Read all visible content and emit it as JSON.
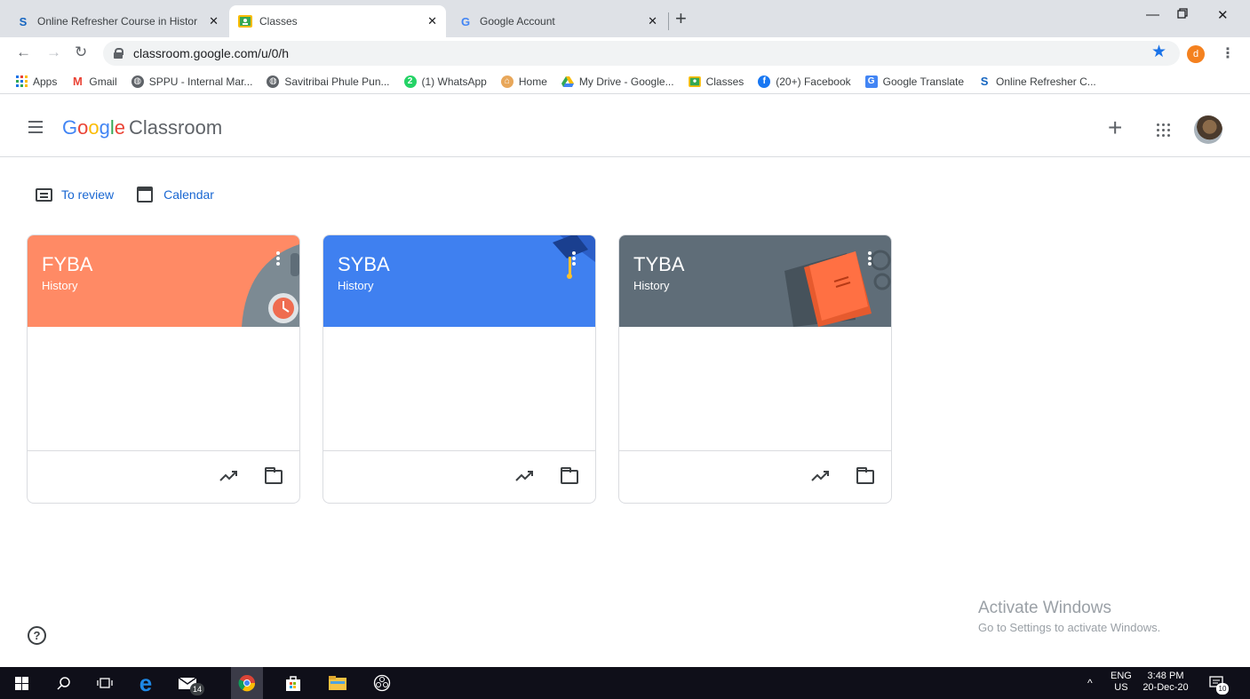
{
  "browser": {
    "tabs": [
      {
        "title": "Online Refresher Course in Histor",
        "favicon": "S",
        "favicon_color": "#1565c0",
        "active": false
      },
      {
        "title": "Classes",
        "favicon": "classroom-icon",
        "favicon_color": "#fbbc04",
        "active": true
      },
      {
        "title": "Google Account",
        "favicon": "G",
        "favicon_color": "#4285f4",
        "active": false
      }
    ],
    "url": "classroom.google.com/u/0/h",
    "profile_initial": "d",
    "bookmarks": [
      {
        "label": "Apps",
        "icon": "apps-grid-icon"
      },
      {
        "label": "Gmail",
        "icon": "gmail-icon"
      },
      {
        "label": "SPPU - Internal Mar...",
        "icon": "globe-icon"
      },
      {
        "label": "Savitribai Phule Pun...",
        "icon": "globe-icon"
      },
      {
        "label": "(1) WhatsApp",
        "icon": "whatsapp-icon"
      },
      {
        "label": "Home",
        "icon": "home-icon"
      },
      {
        "label": "My Drive - Google...",
        "icon": "drive-icon"
      },
      {
        "label": "Classes",
        "icon": "classroom-icon"
      },
      {
        "label": "(20+) Facebook",
        "icon": "facebook-icon"
      },
      {
        "label": "Google Translate",
        "icon": "translate-icon"
      },
      {
        "label": "Online Refresher C...",
        "icon": "s-icon"
      }
    ]
  },
  "classroom": {
    "logo_google": "Google",
    "logo_product": "Classroom",
    "nav": {
      "to_review": "To review",
      "calendar": "Calendar"
    },
    "cards": [
      {
        "title": "FYBA",
        "subtitle": "History",
        "color": "#ff8a65",
        "theme": "clock"
      },
      {
        "title": "SYBA",
        "subtitle": "History",
        "color": "#3f80f0",
        "theme": "graduation"
      },
      {
        "title": "TYBA",
        "subtitle": "History",
        "color": "#5f6d78",
        "theme": "book"
      }
    ]
  },
  "watermark": {
    "line1": "Activate Windows",
    "line2": "Go to Settings to activate Windows."
  },
  "taskbar": {
    "language": "ENG",
    "region": "US",
    "time": "3:48 PM",
    "date": "20-Dec-20",
    "mail_badge": "14",
    "notification_count": "10"
  }
}
